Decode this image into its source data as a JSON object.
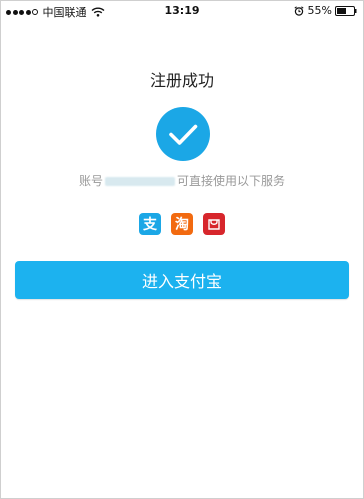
{
  "status_bar": {
    "carrier": "中国联通",
    "time": "13:19",
    "battery": "55%"
  },
  "main": {
    "title": "注册成功",
    "account_prefix": "账号",
    "account_suffix": "可直接使用以下服务",
    "services": [
      {
        "glyph": "支",
        "icon": "alipay-icon"
      },
      {
        "glyph": "淘",
        "icon": "taobao-icon"
      },
      {
        "glyph": "",
        "icon": "tmall-icon"
      }
    ],
    "enter_button_label": "进入支付宝"
  },
  "colors": {
    "accent": "#1cb2ef",
    "check_circle": "#1ba7e6",
    "taobao": "#f26a10",
    "tmall": "#d7262c",
    "secondary_text": "#999999"
  }
}
